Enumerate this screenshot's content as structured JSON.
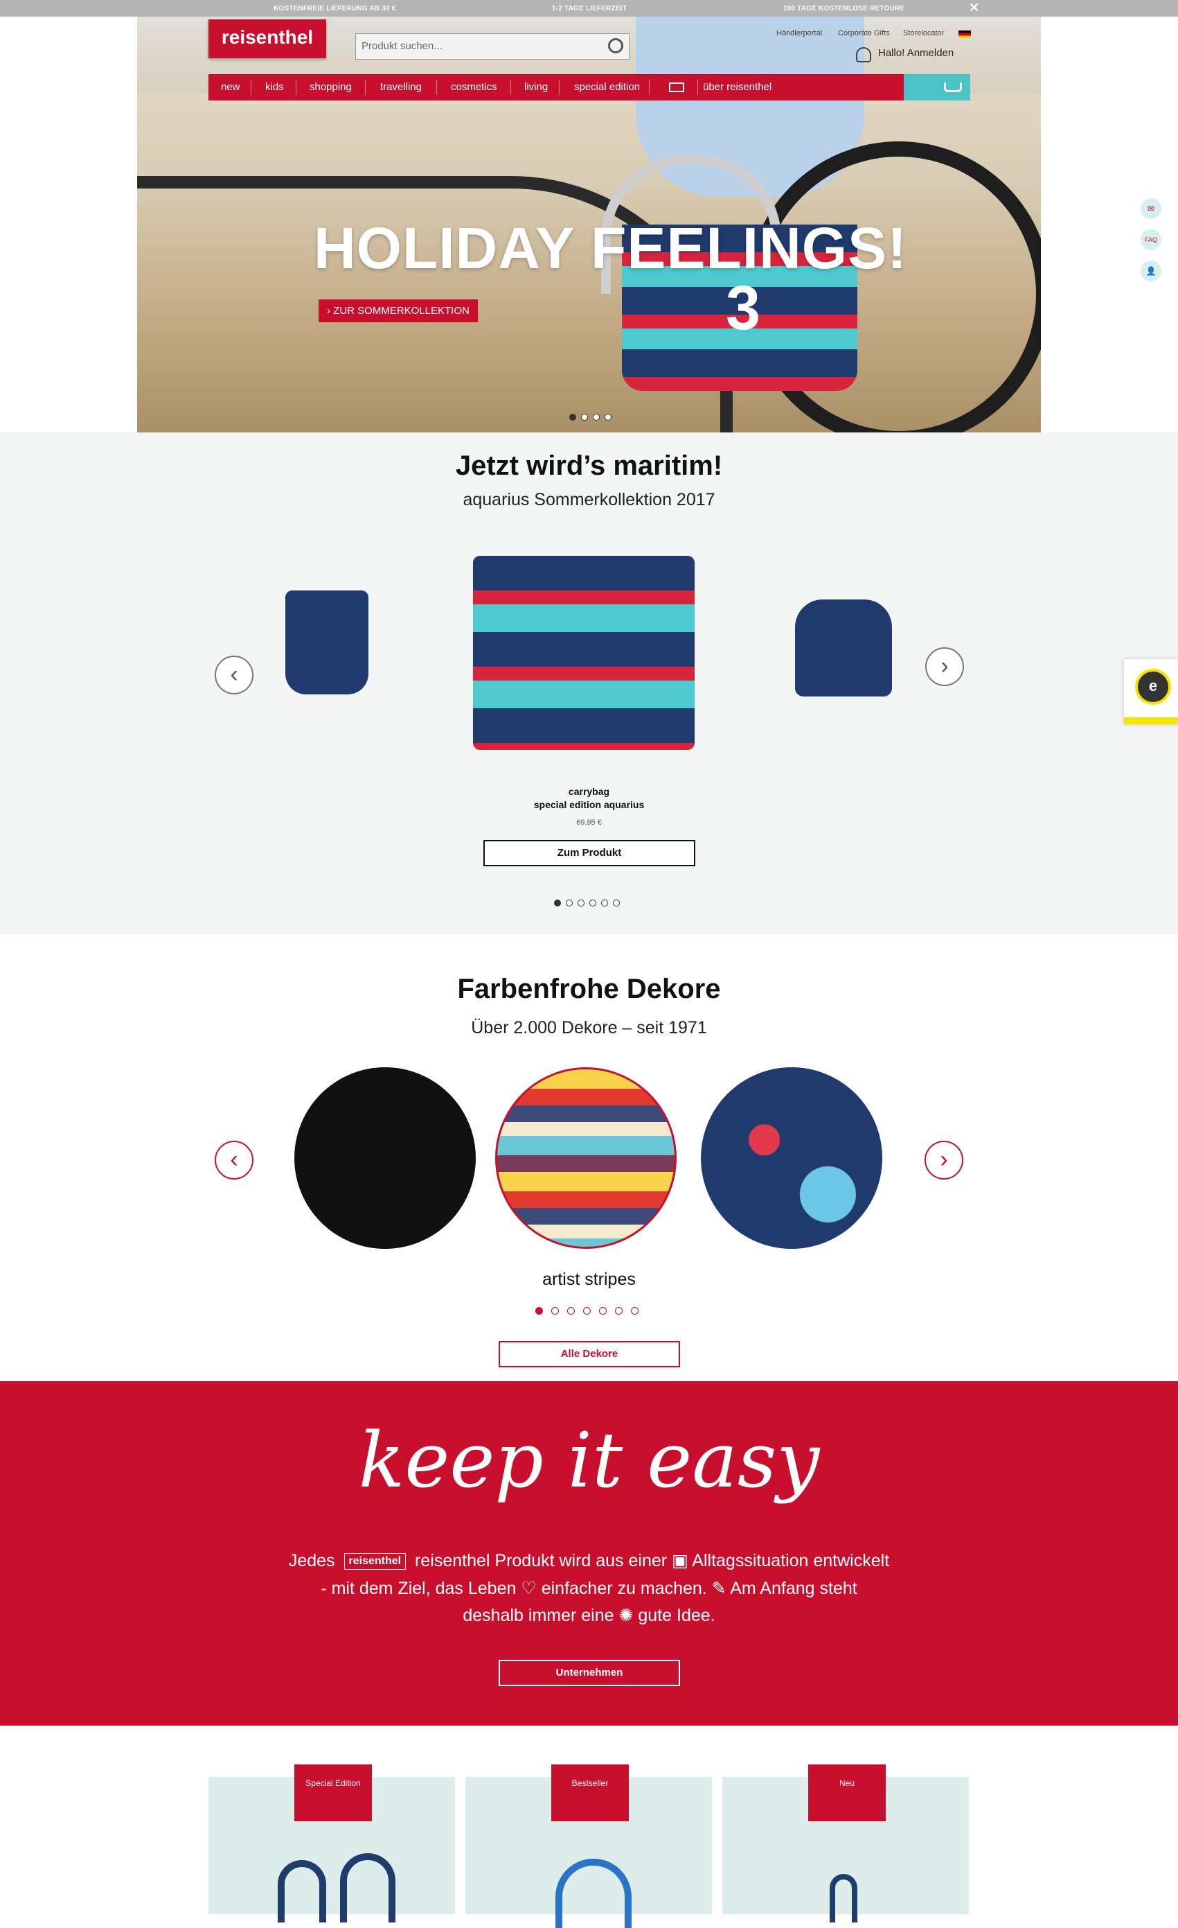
{
  "topbar": {
    "left": "KOSTENFREIE LIEFERUNG AB 30 €",
    "center": "1-2 TAGE LIEFERZEIT",
    "right": "100 TAGE KOSTENLOSE RETOURE",
    "close": "✕"
  },
  "header": {
    "logo": "reisenthel",
    "search_placeholder": "Produkt suchen...",
    "utils": [
      "Händlerportal",
      "Corporate Gifts",
      "Storelocator"
    ],
    "login": "Hallo! Anmelden"
  },
  "nav": {
    "items": [
      "new",
      "kids",
      "shopping",
      "travelling",
      "cosmetics",
      "living",
      "special edition",
      "über reisenthel"
    ]
  },
  "side_buttons": [
    "✉",
    "FAQ",
    "👤"
  ],
  "hero": {
    "title": "HOLIDAY FEELINGS!",
    "cta": "› ZUR SOMMERKOLLEKTION",
    "basket_number": "3",
    "slides": 4,
    "active_slide": 0
  },
  "maritim": {
    "title": "Jetzt wird’s maritim!",
    "subtitle": "aquarius Sommerkollektion 2017",
    "product_name_1": "carrybag",
    "product_name_2": "special edition aquarius",
    "price": "69,95 €",
    "button": "Zum Produkt",
    "slides": 6,
    "active_slide": 0
  },
  "dekore": {
    "title": "Farbenfrohe Dekore",
    "subtitle": "Über 2.000 Dekore – seit 1971",
    "active_name": "artist stripes",
    "button": "Alle Dekore",
    "slides": 7,
    "active_slide": 0
  },
  "keep": {
    "script": "keep it easy",
    "line1_a": "Jedes",
    "line1_logo": "reisenthel",
    "line1_b": "reisenthel Produkt wird aus einer",
    "line1_c": "Alltagssituation entwickelt",
    "line2_a": "- mit dem Ziel, das Leben",
    "line2_b": "einfacher zu machen.",
    "line2_c": "Am Anfang steht",
    "line3_a": "deshalb immer eine",
    "line3_b": "gute Idee.",
    "button": "Unternehmen"
  },
  "tiles": [
    "Special Edition",
    "Bestseller",
    "Neu"
  ],
  "trusted": {
    "seal": "e"
  },
  "arrows": {
    "left": "‹",
    "right": "›"
  },
  "colors": {
    "brand_red": "#c8102e",
    "teal": "#4bc3c6",
    "topbar_grey": "#b4b4b4"
  }
}
